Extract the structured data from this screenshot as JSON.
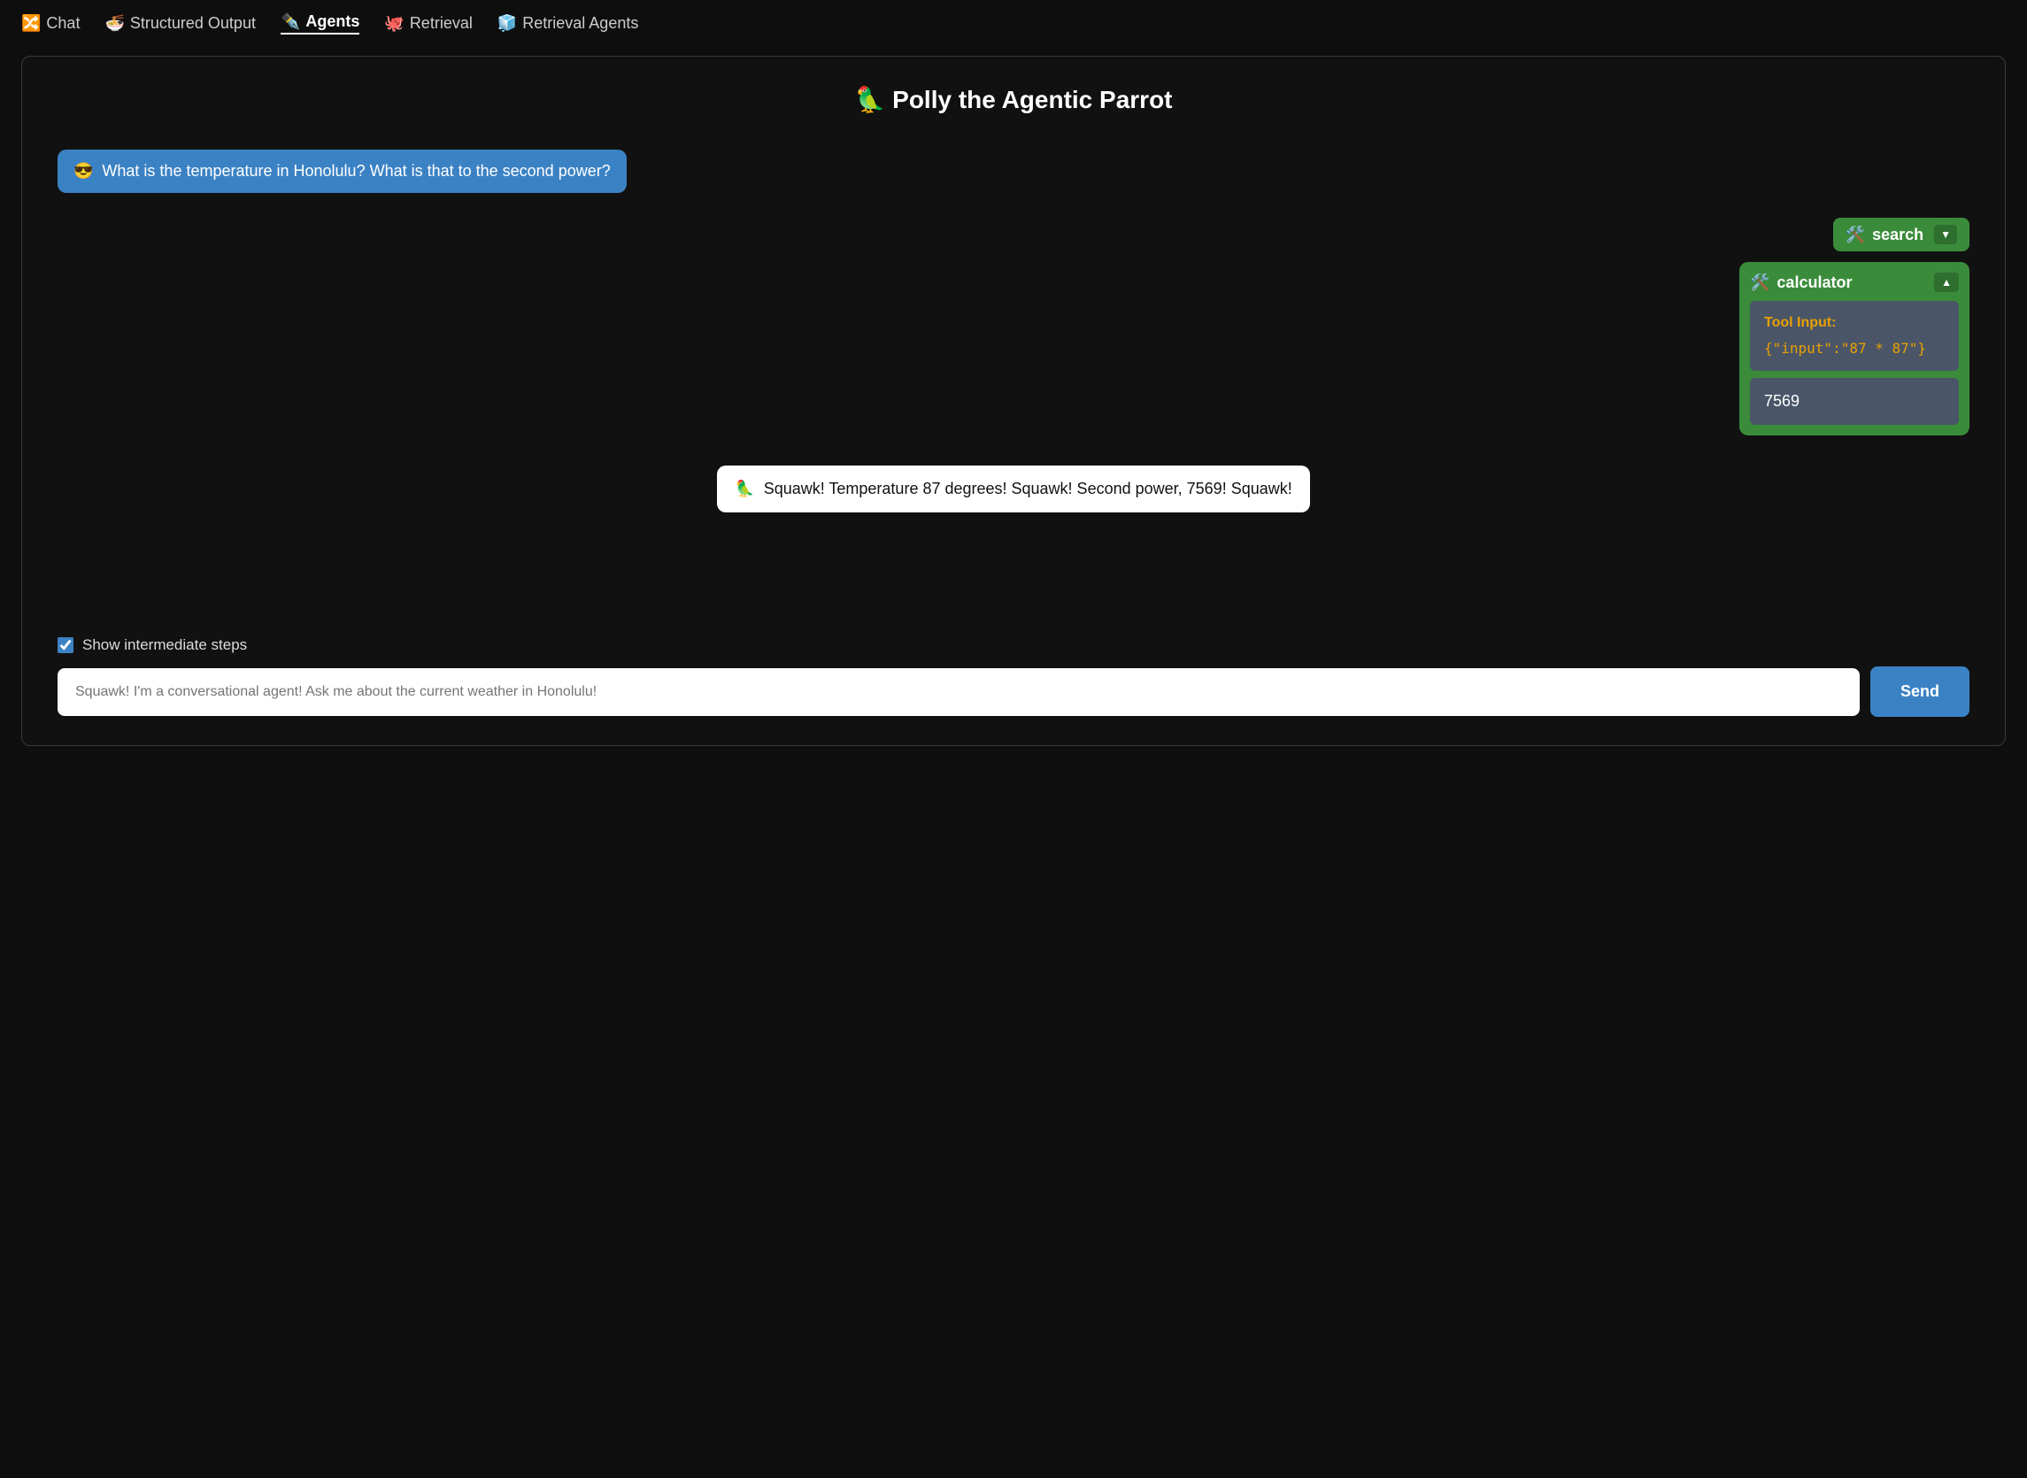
{
  "nav": {
    "items": [
      {
        "id": "chat",
        "emoji": "🔀",
        "label": "Chat",
        "active": false
      },
      {
        "id": "structured-output",
        "emoji": "🍜",
        "label": "Structured Output",
        "active": false
      },
      {
        "id": "agents",
        "emoji": "✒️",
        "label": "Agents",
        "active": true
      },
      {
        "id": "retrieval",
        "emoji": "🐙",
        "label": "Retrieval",
        "active": false
      },
      {
        "id": "retrieval-agents",
        "emoji": "🧊",
        "label": "Retrieval Agents",
        "active": false
      }
    ]
  },
  "page": {
    "title": "🦜 Polly the Agentic Parrot"
  },
  "chat": {
    "user_message_emoji": "😎",
    "user_message": "What is the temperature in Honolulu? What is that to the second power?",
    "search_tool_emoji": "🛠️",
    "search_tool_label": "search",
    "search_dropdown_symbol": "▼",
    "calculator_tool_emoji": "🛠️",
    "calculator_tool_label": "calculator",
    "calculator_collapse_symbol": "▲",
    "tool_input_label": "Tool Input:",
    "tool_input_value": "{\"input\":\"87 * 87\"}",
    "tool_output_value": "7569",
    "assistant_emoji": "🦜",
    "assistant_message": "Squawk! Temperature 87 degrees! Squawk! Second power, 7569! Squawk!"
  },
  "bottom": {
    "checkbox_label": "Show intermediate steps",
    "checkbox_checked": true,
    "input_placeholder": "Squawk! I'm a conversational agent! Ask me about the current weather in Honolulu!",
    "send_button_label": "Send"
  }
}
